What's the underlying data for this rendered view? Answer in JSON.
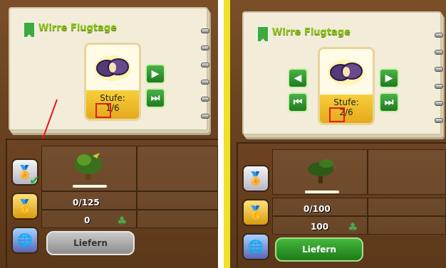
{
  "panels": {
    "left": {
      "title": "Wirre Flugtage",
      "stufe_label": "Stufe:",
      "level": "1/6",
      "progress": "0/125",
      "points": "0",
      "deliver_label": "Liefern",
      "deliver_enabled": false,
      "badges": [
        "medal-silver-check-icon",
        "medal-gold-locked-icon",
        "globe-locked-icon"
      ]
    },
    "right": {
      "title": "Wirre Flugtage",
      "stufe_label": "Stufe:",
      "level": "2/6",
      "progress": "0/100",
      "points": "100",
      "deliver_label": "Liefern",
      "deliver_enabled": true,
      "badges": [
        "medal-silver-icon",
        "medal-gold-locked-icon",
        "globe-locked-icon"
      ]
    }
  },
  "colors": {
    "wood": "#6b4321",
    "paper": "#f2ecd9",
    "green_button": "#2f9a2f",
    "title": "#8ec21a",
    "highlight": "#e21a1a",
    "edge_yellow": "#f1e02a"
  }
}
